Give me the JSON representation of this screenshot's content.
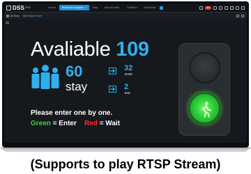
{
  "topbar": {
    "brand": "DSS",
    "brand_suffix": "PRO",
    "tabs": [
      {
        "label": "Levels",
        "active": false
      },
      {
        "label": "Business Analysis",
        "active": true
      },
      {
        "label": "Map",
        "active": false
      },
      {
        "label": "AlarmCenter",
        "active": false
      },
      {
        "label": "TVMatrix",
        "active": false
      },
      {
        "label": "Download",
        "active": false
      }
    ],
    "tab_close": "×",
    "add_tab": "+",
    "alarm_count": "99+"
  },
  "subbar": {
    "root": "All Store",
    "current": "Store Bayer Hove"
  },
  "display": {
    "available_label": "Avaliable",
    "available_count": "109",
    "stay_count": "60",
    "stay_label": "stay",
    "enter_count": "32",
    "enter_label": "Enter",
    "exit_count": "2",
    "exit_label": "Exit",
    "message": "Please enter one by one.",
    "legend_green": "Green",
    "legend_green_meaning": "= Enter",
    "legend_red": "Red",
    "legend_red_meaning": "= Wait"
  },
  "signal": {
    "state": "green",
    "icon": "walking-person-icon"
  },
  "caption": "(Supports to play RTSP Stream)",
  "colors": {
    "accent_blue": "#2fb0ee",
    "tab_active": "#1f8fd6",
    "green": "#3fd23f",
    "red": "#ff3030",
    "screen_bg": "#15181d"
  }
}
